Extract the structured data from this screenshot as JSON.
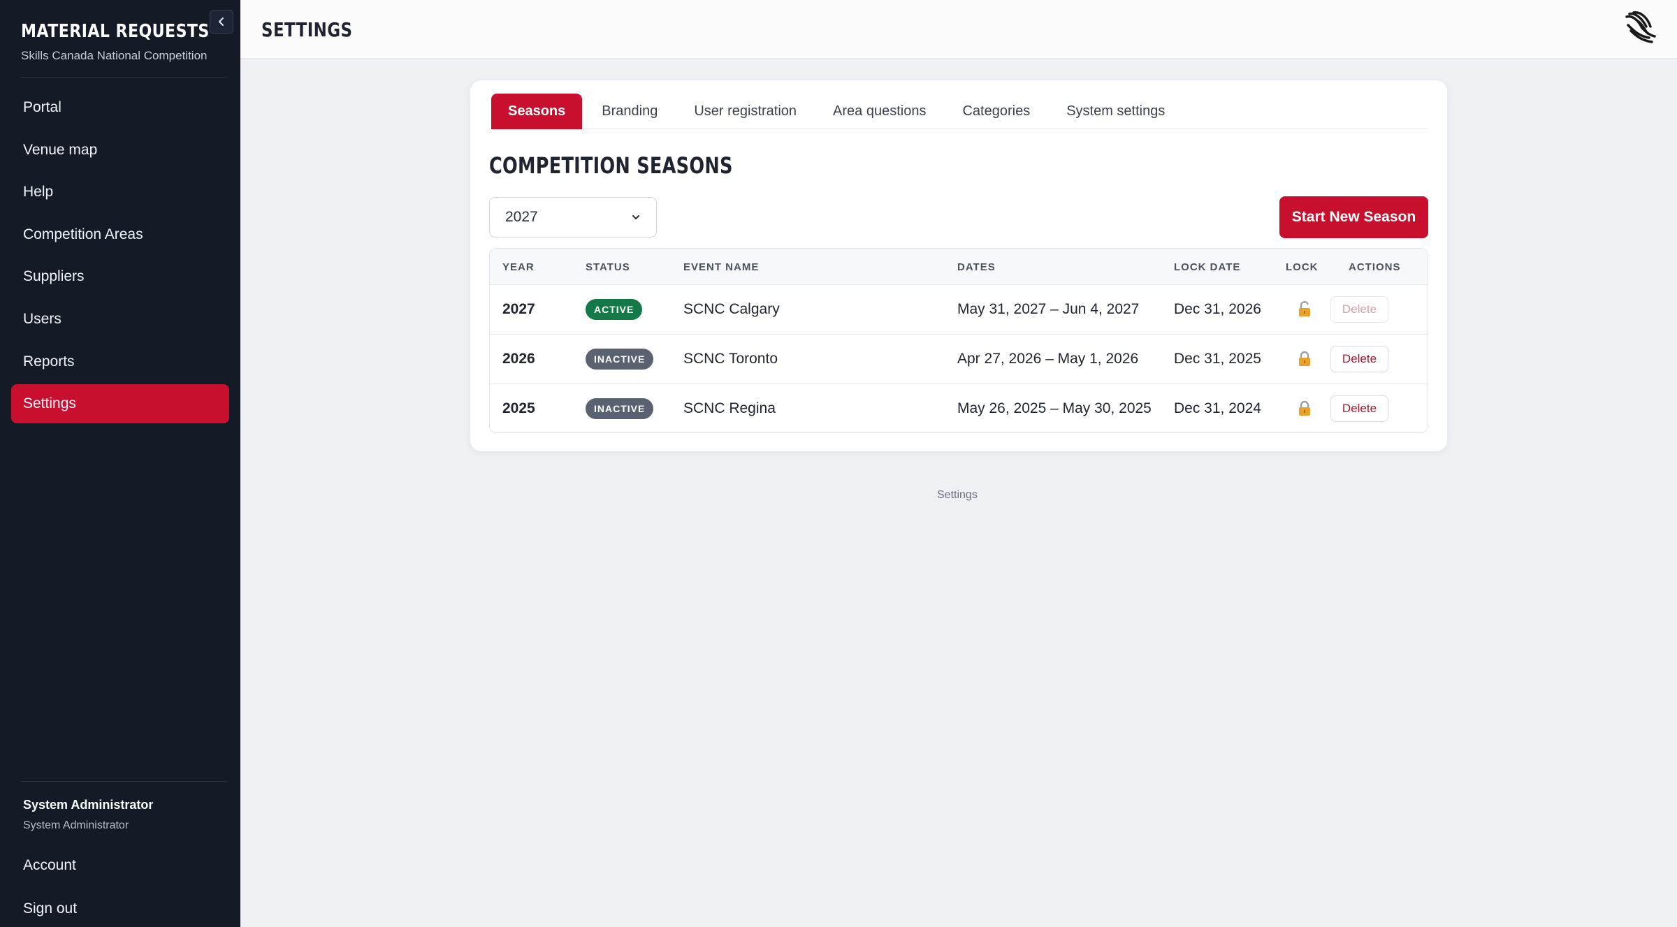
{
  "sidebar": {
    "brand_title": "MATERIAL REQUESTS",
    "brand_subtitle": "Skills Canada National Competition",
    "items": [
      {
        "label": "Portal"
      },
      {
        "label": "Venue map"
      },
      {
        "label": "Help"
      },
      {
        "label": "Competition Areas"
      },
      {
        "label": "Suppliers"
      },
      {
        "label": "Users"
      },
      {
        "label": "Reports"
      },
      {
        "label": "Settings",
        "active": true
      }
    ],
    "user_name": "System Administrator",
    "user_role": "System Administrator",
    "account_label": "Account",
    "signout_label": "Sign out"
  },
  "header": {
    "title": "SETTINGS"
  },
  "tabs": [
    {
      "label": "Seasons",
      "active": true
    },
    {
      "label": "Branding"
    },
    {
      "label": "User registration"
    },
    {
      "label": "Area questions"
    },
    {
      "label": "Categories"
    },
    {
      "label": "System settings"
    }
  ],
  "main": {
    "section_title": "COMPETITION SEASONS",
    "season_select_value": "2027",
    "new_season_label": "Start New Season",
    "table": {
      "headers": [
        "YEAR",
        "STATUS",
        "EVENT NAME",
        "DATES",
        "LOCK DATE",
        "LOCK",
        "ACTIONS"
      ],
      "rows": [
        {
          "year": "2027",
          "status": "ACTIVE",
          "event": "SCNC Calgary",
          "dates": "May 31, 2027 – Jun 4, 2027",
          "lock_date": "Dec 31, 2026",
          "lock": "unlocked-icon",
          "action": "Delete"
        },
        {
          "year": "2026",
          "status": "INACTIVE",
          "event": "SCNC Toronto",
          "dates": "Apr 27, 2026 – May 1, 2026",
          "lock_date": "Dec 31, 2025",
          "lock": "lock-icon",
          "action": "Delete"
        },
        {
          "year": "2025",
          "status": "INACTIVE",
          "event": "SCNC Regina",
          "dates": "May 26, 2025 – May 30, 2025",
          "lock_date": "Dec 31, 2024",
          "lock": "lock-icon",
          "action": "Delete"
        }
      ]
    }
  },
  "footer": {
    "label": "Settings"
  },
  "colors": {
    "accent": "#c8102e",
    "sidebar_bg": "#141a26",
    "active_badge": "#137a47",
    "inactive_badge": "#5a6170",
    "lock": "#e8a22c"
  }
}
